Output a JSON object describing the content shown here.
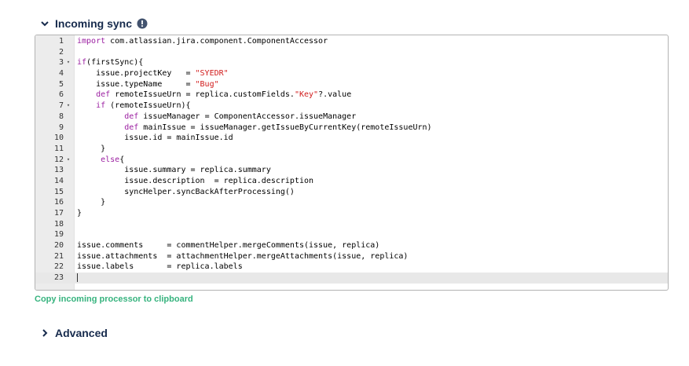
{
  "incoming_sync": {
    "title": "Incoming sync",
    "info_icon": "exclamation-circle-icon",
    "expand_icon": "chevron-down-icon"
  },
  "editor": {
    "lines": [
      {
        "n": "1",
        "fold": false,
        "segs": [
          {
            "t": "import",
            "c": "kw"
          },
          {
            "t": " com.atlassian.jira.component.ComponentAccessor"
          }
        ]
      },
      {
        "n": "2",
        "fold": false,
        "segs": []
      },
      {
        "n": "3",
        "fold": true,
        "segs": [
          {
            "t": "if",
            "c": "kw"
          },
          {
            "t": "(firstSync){"
          }
        ]
      },
      {
        "n": "4",
        "fold": false,
        "segs": [
          {
            "t": "    issue.projectKey   = "
          },
          {
            "t": "\"SYEDR\"",
            "c": "str"
          }
        ]
      },
      {
        "n": "5",
        "fold": false,
        "segs": [
          {
            "t": "    issue.typeName     = "
          },
          {
            "t": "\"Bug\"",
            "c": "str"
          }
        ]
      },
      {
        "n": "6",
        "fold": false,
        "segs": [
          {
            "t": "    "
          },
          {
            "t": "def",
            "c": "kw"
          },
          {
            "t": " remoteIssueUrn = replica.customFields."
          },
          {
            "t": "\"Key\"",
            "c": "str"
          },
          {
            "t": "?.value"
          }
        ]
      },
      {
        "n": "7",
        "fold": true,
        "segs": [
          {
            "t": "    "
          },
          {
            "t": "if",
            "c": "kw"
          },
          {
            "t": " (remoteIssueUrn){"
          }
        ]
      },
      {
        "n": "8",
        "fold": false,
        "segs": [
          {
            "t": "          "
          },
          {
            "t": "def",
            "c": "kw"
          },
          {
            "t": " issueManager = ComponentAccessor.issueManager"
          }
        ]
      },
      {
        "n": "9",
        "fold": false,
        "segs": [
          {
            "t": "          "
          },
          {
            "t": "def",
            "c": "kw"
          },
          {
            "t": " mainIssue = issueManager.getIssueByCurrentKey(remoteIssueUrn)"
          }
        ]
      },
      {
        "n": "10",
        "fold": false,
        "segs": [
          {
            "t": "          issue.id = mainIssue.id"
          }
        ]
      },
      {
        "n": "11",
        "fold": false,
        "segs": [
          {
            "t": "     }"
          }
        ]
      },
      {
        "n": "12",
        "fold": true,
        "segs": [
          {
            "t": "     "
          },
          {
            "t": "else",
            "c": "kw"
          },
          {
            "t": "{"
          }
        ]
      },
      {
        "n": "13",
        "fold": false,
        "segs": [
          {
            "t": "          issue.summary = replica.summary"
          }
        ]
      },
      {
        "n": "14",
        "fold": false,
        "segs": [
          {
            "t": "          issue.description  = replica.description"
          }
        ]
      },
      {
        "n": "15",
        "fold": false,
        "segs": [
          {
            "t": "          syncHelper.syncBackAfterProcessing()"
          }
        ]
      },
      {
        "n": "16",
        "fold": false,
        "segs": [
          {
            "t": "     }"
          }
        ]
      },
      {
        "n": "17",
        "fold": false,
        "segs": [
          {
            "t": "}"
          }
        ]
      },
      {
        "n": "18",
        "fold": false,
        "segs": []
      },
      {
        "n": "19",
        "fold": false,
        "segs": []
      },
      {
        "n": "20",
        "fold": false,
        "segs": [
          {
            "t": "issue.comments     = commentHelper.mergeComments(issue, replica)"
          }
        ]
      },
      {
        "n": "21",
        "fold": false,
        "segs": [
          {
            "t": "issue.attachments  = attachmentHelper.mergeAttachments(issue, replica)"
          }
        ]
      },
      {
        "n": "22",
        "fold": false,
        "segs": [
          {
            "t": "issue.labels       = replica.labels"
          }
        ]
      },
      {
        "n": "23",
        "fold": false,
        "segs": [],
        "active": true,
        "cursor": true
      }
    ]
  },
  "copy_link": "Copy incoming processor to clipboard",
  "advanced": {
    "title": "Advanced",
    "expand_icon": "chevron-right-icon"
  }
}
